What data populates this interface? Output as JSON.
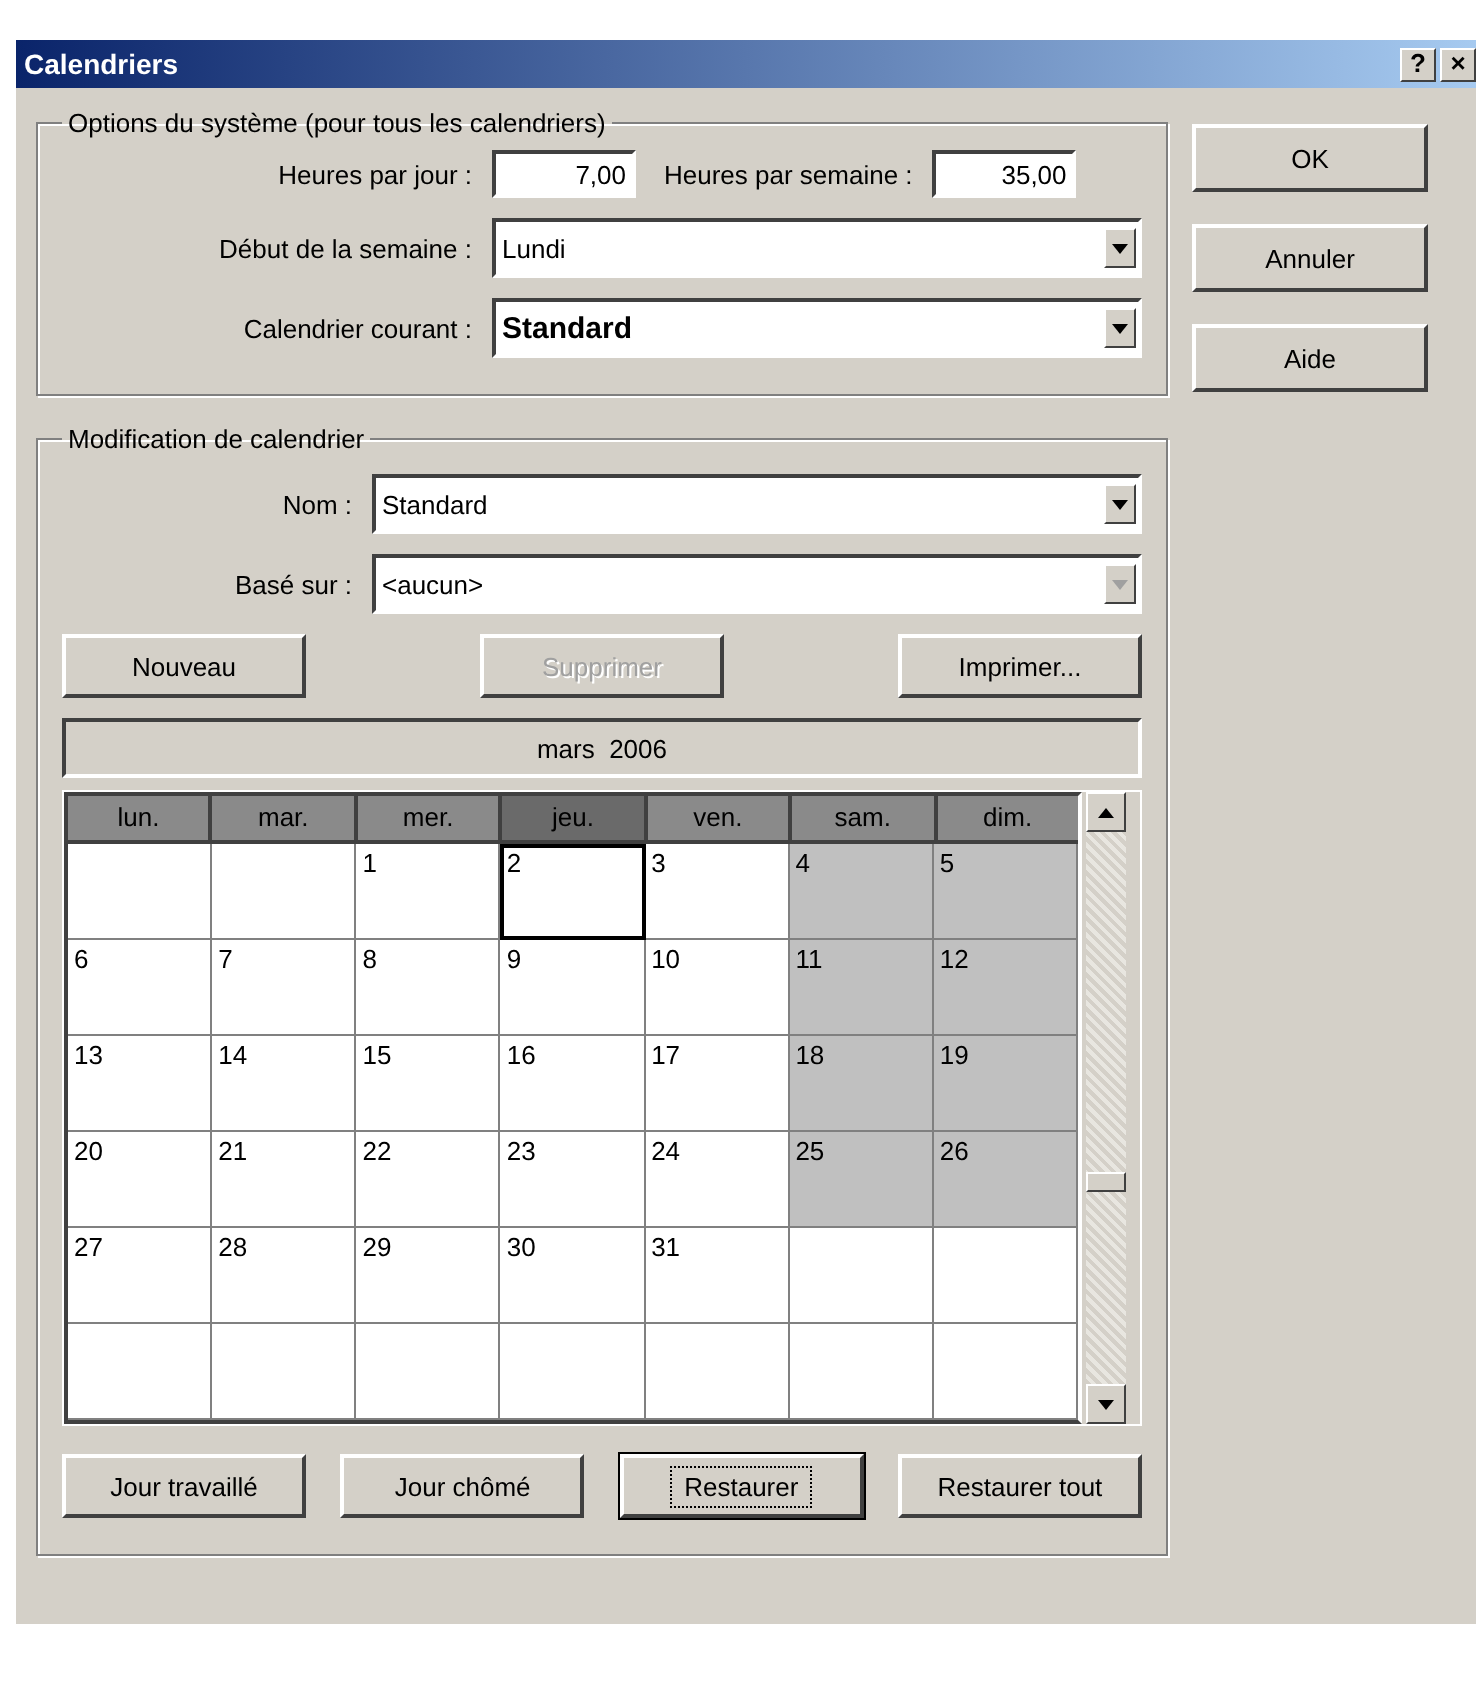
{
  "window": {
    "title": "Calendriers",
    "help_button": "?",
    "close_button": "×"
  },
  "system_options": {
    "legend": "Options du système (pour tous les calendriers)",
    "hours_per_day": {
      "label": "Heures par jour :",
      "value": "7,00"
    },
    "hours_per_week": {
      "label": "Heures par semaine :",
      "value": "35,00"
    },
    "week_start": {
      "label": "Début de la semaine :",
      "value": "Lundi"
    },
    "current_calendar": {
      "label": "Calendrier courant :",
      "value": "Standard"
    }
  },
  "calendar_edit": {
    "legend": "Modification de calendrier",
    "name": {
      "label": "Nom :",
      "value": "Standard",
      "disabled": false
    },
    "based_on": {
      "label": "Basé sur :",
      "value": "<aucun>",
      "disabled": true
    },
    "buttons": [
      {
        "label": "Nouveau",
        "disabled": false
      },
      {
        "label": "Supprimer",
        "disabled": true
      },
      {
        "label": "Imprimer...",
        "disabled": false
      }
    ],
    "month": "mars  2006",
    "weekdays": [
      {
        "label": "lun.",
        "selected": false
      },
      {
        "label": "mar.",
        "selected": false
      },
      {
        "label": "mer.",
        "selected": false
      },
      {
        "label": "jeu.",
        "selected": true
      },
      {
        "label": "ven.",
        "selected": false
      },
      {
        "label": "sam.",
        "selected": false
      },
      {
        "label": "dim.",
        "selected": false
      }
    ],
    "weeks": [
      [
        {
          "nonworking": false,
          "selected": false
        },
        {
          "nonworking": false,
          "selected": false
        },
        {
          "day": "1",
          "nonworking": false,
          "selected": false
        },
        {
          "day": "2",
          "nonworking": false,
          "selected": true
        },
        {
          "day": "3",
          "nonworking": false,
          "selected": false
        },
        {
          "day": "4",
          "nonworking": true,
          "selected": false
        },
        {
          "day": "5",
          "nonworking": true,
          "selected": false
        }
      ],
      [
        {
          "day": "6",
          "nonworking": false,
          "selected": false
        },
        {
          "day": "7",
          "nonworking": false,
          "selected": false
        },
        {
          "day": "8",
          "nonworking": false,
          "selected": false
        },
        {
          "day": "9",
          "nonworking": false,
          "selected": false
        },
        {
          "day": "10",
          "nonworking": false,
          "selected": false
        },
        {
          "day": "11",
          "nonworking": true,
          "selected": false
        },
        {
          "day": "12",
          "nonworking": true,
          "selected": false
        }
      ],
      [
        {
          "day": "13",
          "nonworking": false,
          "selected": false
        },
        {
          "day": "14",
          "nonworking": false,
          "selected": false
        },
        {
          "day": "15",
          "nonworking": false,
          "selected": false
        },
        {
          "day": "16",
          "nonworking": false,
          "selected": false
        },
        {
          "day": "17",
          "nonworking": false,
          "selected": false
        },
        {
          "day": "18",
          "nonworking": true,
          "selected": false
        },
        {
          "day": "19",
          "nonworking": true,
          "selected": false
        }
      ],
      [
        {
          "day": "20",
          "nonworking": false,
          "selected": false
        },
        {
          "day": "21",
          "nonworking": false,
          "selected": false
        },
        {
          "day": "22",
          "nonworking": false,
          "selected": false
        },
        {
          "day": "23",
          "nonworking": false,
          "selected": false
        },
        {
          "day": "24",
          "nonworking": false,
          "selected": false
        },
        {
          "day": "25",
          "nonworking": true,
          "selected": false
        },
        {
          "day": "26",
          "nonworking": true,
          "selected": false
        }
      ],
      [
        {
          "day": "27",
          "nonworking": false,
          "selected": false
        },
        {
          "day": "28",
          "nonworking": false,
          "selected": false
        },
        {
          "day": "29",
          "nonworking": false,
          "selected": false
        },
        {
          "day": "30",
          "nonworking": false,
          "selected": false
        },
        {
          "day": "31",
          "nonworking": false,
          "selected": false
        },
        {
          "nonworking": false,
          "selected": false
        },
        {
          "nonworking": false,
          "selected": false
        }
      ],
      [
        {
          "nonworking": false,
          "selected": false
        },
        {
          "nonworking": false,
          "selected": false
        },
        {
          "nonworking": false,
          "selected": false
        },
        {
          "nonworking": false,
          "selected": false
        },
        {
          "nonworking": false,
          "selected": false
        },
        {
          "nonworking": false,
          "selected": false
        },
        {
          "nonworking": false,
          "selected": false
        }
      ]
    ],
    "day_buttons": [
      {
        "label": "Jour travaillé",
        "focused": false
      },
      {
        "label": "Jour chômé",
        "focused": false
      },
      {
        "label": "Restaurer",
        "focused": true
      },
      {
        "label": "Restaurer tout",
        "focused": false
      }
    ]
  },
  "dialog_buttons": [
    "OK",
    "Annuler",
    "Aide"
  ]
}
